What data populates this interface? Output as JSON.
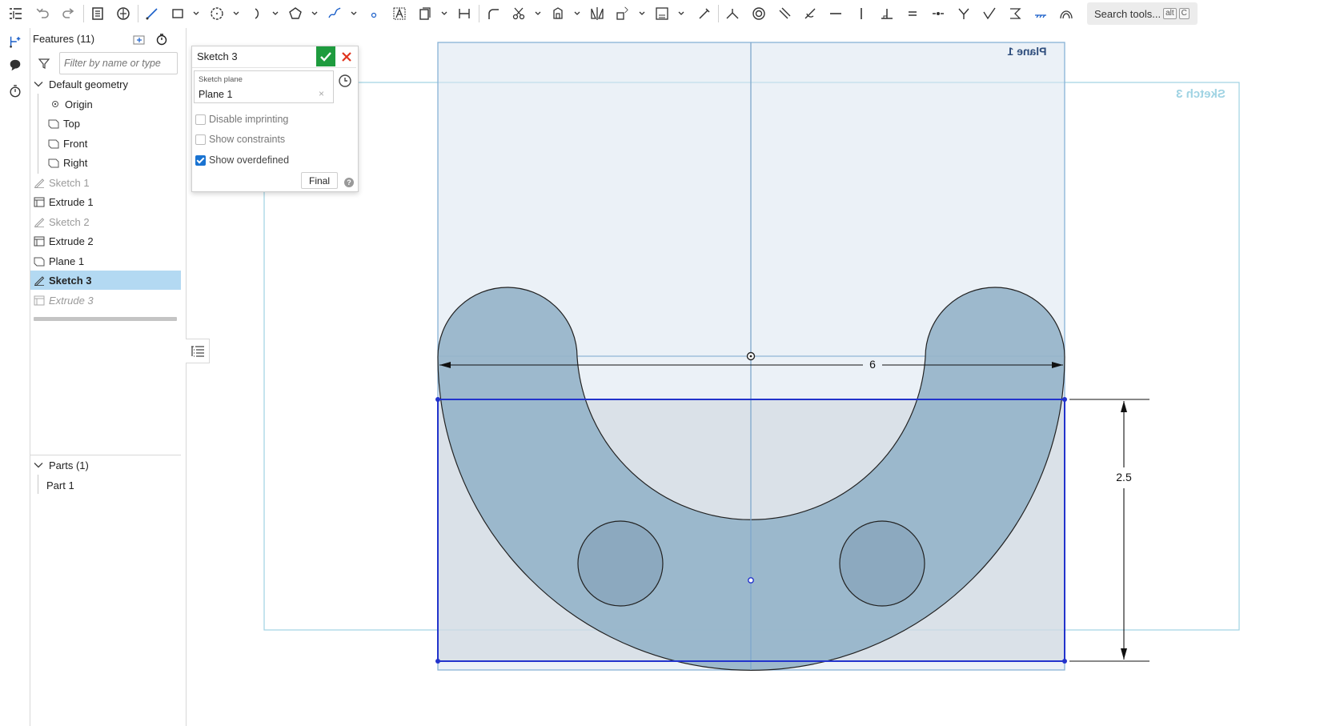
{
  "toolbar": {
    "search_placeholder": "Search tools...",
    "search_shortcut_1": "alt",
    "search_shortcut_2": "C"
  },
  "features_panel": {
    "title": "Features (11)",
    "filter_placeholder": "Filter by name or type",
    "default_geometry_label": "Default geometry",
    "items": [
      {
        "label": "Origin",
        "icon": "origin-icon",
        "state": "normal"
      },
      {
        "label": "Top",
        "icon": "plane-icon",
        "state": "normal"
      },
      {
        "label": "Front",
        "icon": "plane-icon",
        "state": "normal"
      },
      {
        "label": "Right",
        "icon": "plane-icon",
        "state": "normal"
      },
      {
        "label": "Sketch 1",
        "icon": "sketch-icon",
        "state": "muted"
      },
      {
        "label": "Extrude 1",
        "icon": "extrude-icon",
        "state": "normal"
      },
      {
        "label": "Sketch 2",
        "icon": "sketch-icon",
        "state": "muted"
      },
      {
        "label": "Extrude 2",
        "icon": "extrude-icon",
        "state": "normal"
      },
      {
        "label": "Plane 1",
        "icon": "plane-icon",
        "state": "normal"
      },
      {
        "label": "Sketch 3",
        "icon": "sketch-icon",
        "state": "selected"
      },
      {
        "label": "Extrude 3",
        "icon": "extrude-icon",
        "state": "rolled-back"
      }
    ],
    "parts_label": "Parts (1)",
    "parts": [
      "Part 1"
    ]
  },
  "sketch_dialog": {
    "title": "Sketch 3",
    "sketch_plane_label": "Sketch plane",
    "sketch_plane_value": "Plane 1",
    "disable_imprinting_label": "Disable imprinting",
    "disable_imprinting_checked": false,
    "show_constraints_label": "Show constraints",
    "show_constraints_checked": false,
    "show_overdefined_label": "Show overdefined",
    "show_overdefined_checked": true,
    "final_label": "Final"
  },
  "canvas": {
    "plane_label": "Plane 1",
    "sketch_label": "Sketch 3",
    "dimension_width": "6",
    "dimension_height": "2.5"
  },
  "colors": {
    "accent": "#1a73d1",
    "selection": "#b3d9f2",
    "confirm_green": "#1e9b3e",
    "cancel_red": "#e0341e",
    "part_fill": "#9ab6c8",
    "sketch_line": "#2233cc"
  }
}
